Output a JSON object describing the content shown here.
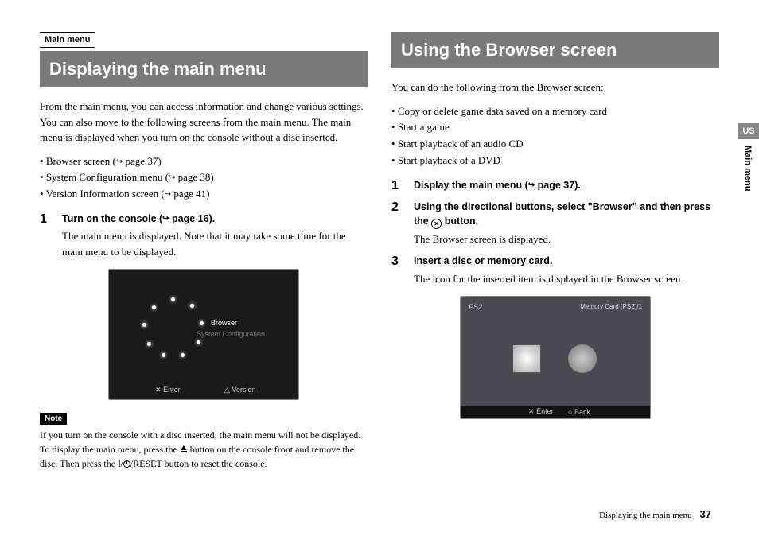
{
  "left": {
    "breadcrumb": "Main menu",
    "title": "Displaying the main menu",
    "intro": "From the main menu, you can access information and change various settings. You can also move to the following screens from the main menu. The main menu is displayed when you turn on the console without a disc inserted.",
    "bullets": [
      {
        "text": "Browser screen (",
        "ref": "page 37)"
      },
      {
        "text": "System Configuration menu (",
        "ref": "page 38)"
      },
      {
        "text": "Version Information screen (",
        "ref": "page 41)"
      }
    ],
    "step1": {
      "num": "1",
      "head_pre": "Turn on the console (",
      "head_ref": "page 16).",
      "body": "The main menu is displayed. Note that it may take some time for the main menu to be displayed."
    },
    "ss": {
      "browser": "Browser",
      "sysconf": "System Configuration",
      "enter": "Enter",
      "version": "Version",
      "x": "✕",
      "tri": "△"
    },
    "note_tag": "Note",
    "note_body_a": "If you turn on the console with a disc inserted, the main menu will not be displayed. To display the main menu, press the ",
    "note_body_b": " button on the console front and remove the disc. Then press the ",
    "note_body_c": "/RESET button to reset the console.",
    "slash": "/"
  },
  "right": {
    "title": "Using the Browser screen",
    "intro": "You can do the following from the Browser screen:",
    "bullets": [
      "Copy or delete game data saved on a memory card",
      "Start a game",
      "Start playback of an audio CD",
      "Start playback of a DVD"
    ],
    "step1": {
      "num": "1",
      "head_pre": "Display the main menu (",
      "head_ref": "page 37)."
    },
    "step2": {
      "num": "2",
      "head_a": "Using the directional buttons, select \"Browser\" and then press the ",
      "head_b": " button.",
      "body": "The Browser screen is displayed."
    },
    "step3": {
      "num": "3",
      "head": "Insert a disc or memory card.",
      "body": "The icon for the inserted item is displayed in the Browser screen."
    },
    "ss": {
      "ps2": "PS2",
      "mc": "Memory Card (PS2)/1",
      "enter": "Enter",
      "back": "Back",
      "x": "✕",
      "o": "○"
    }
  },
  "side": {
    "us": "US",
    "section": "Main menu"
  },
  "footer": {
    "title": "Displaying the main menu",
    "page": "37"
  }
}
